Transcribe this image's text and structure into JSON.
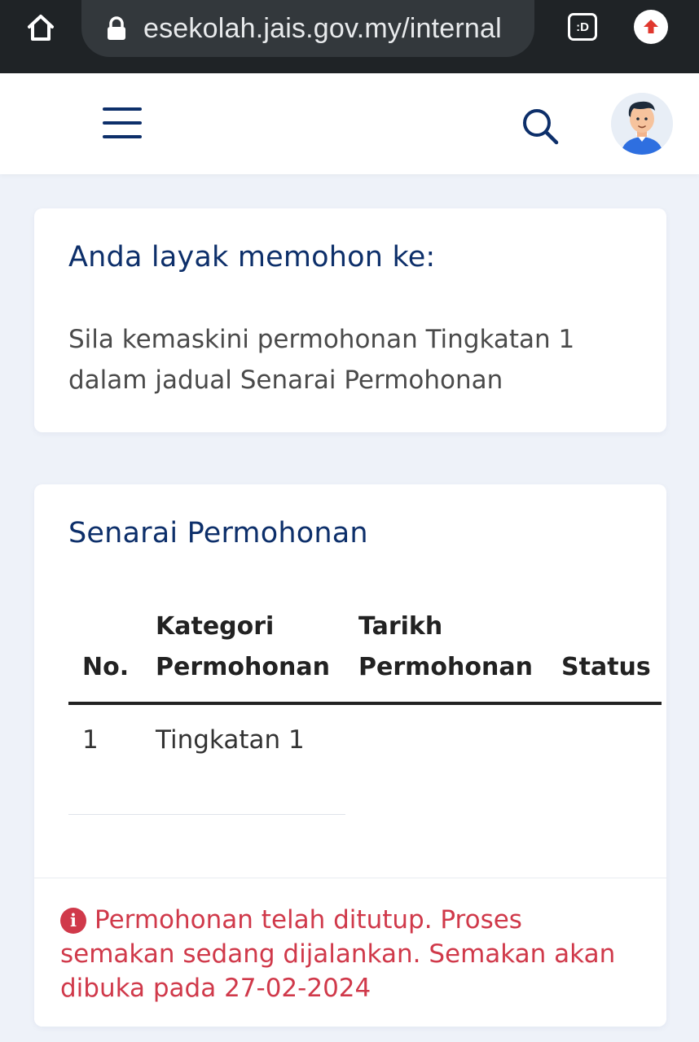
{
  "browser": {
    "url": "esekolah.jais.gov.my/internal",
    "tab_switcher_label": ":D",
    "icons": {
      "home": "home-icon",
      "lock": "lock-icon",
      "extension": "upload-arrow-icon"
    }
  },
  "header": {
    "icons": {
      "menu": "hamburger-menu-icon",
      "search": "search-icon",
      "avatar": "user-avatar"
    }
  },
  "eligibility_card": {
    "title": "Anda layak memohon ke:",
    "message": "Sila kemaskini permohonan Tingkatan 1 dalam jadual Senarai Permohonan"
  },
  "applications_card": {
    "title": "Senarai Permohonan",
    "columns": [
      {
        "line1": "",
        "line2": "No."
      },
      {
        "line1": "Kategori",
        "line2": "Permohonan"
      },
      {
        "line1": "Tarikh",
        "line2": "Permohonan"
      },
      {
        "line1": "",
        "line2": "Status"
      }
    ],
    "rows": [
      {
        "no": "1",
        "category": "Tingkatan 1",
        "date": "",
        "status": ""
      }
    ],
    "alert": "Permohonan telah ditutup. Proses semakan sedang dijalankan. Semakan akan dibuka pada 27-02-2024",
    "alert_icon": "info-icon"
  },
  "colors": {
    "primary": "#0d2f6a",
    "alert": "#d0394a",
    "background": "#eef2f9",
    "browser_bar": "#1f2326"
  }
}
